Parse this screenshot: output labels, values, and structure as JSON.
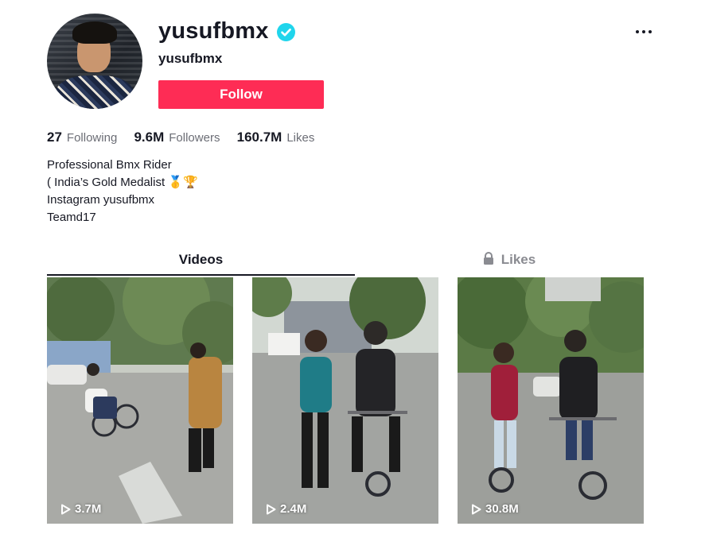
{
  "profile": {
    "username": "yusufbmx",
    "nickname": "yusufbmx",
    "verified": true,
    "follow_label": "Follow"
  },
  "stats": [
    {
      "value": "27",
      "label": "Following"
    },
    {
      "value": "9.6M",
      "label": "Followers"
    },
    {
      "value": "160.7M",
      "label": "Likes"
    }
  ],
  "bio": [
    "Professional Bmx Rider",
    "( India’s Gold Medalist 🥇🏆",
    "Instagram yusufbmx",
    "Teamd17"
  ],
  "tabs": {
    "videos": "Videos",
    "likes": "Likes"
  },
  "videos": [
    {
      "views": "3.7M"
    },
    {
      "views": "2.4M"
    },
    {
      "views": "30.8M"
    }
  ],
  "icons": {
    "verified": "verified-badge-icon",
    "more": "more-options-icon",
    "lock": "lock-icon",
    "play": "play-icon"
  },
  "colors": {
    "accent": "#fe2c55",
    "verified": "#20d5ec",
    "text": "#161823",
    "muted": "#6b6d75"
  }
}
